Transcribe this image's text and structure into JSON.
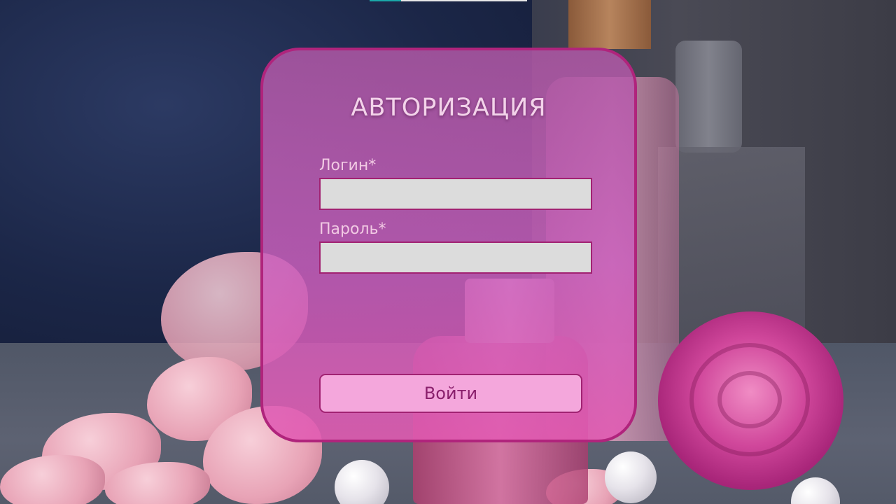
{
  "login": {
    "title": "АВТОРИЗАЦИЯ",
    "login_label": "Логин*",
    "login_value": "",
    "password_label": "Пароль*",
    "password_value": "",
    "submit_label": "Войти"
  },
  "colors": {
    "card_border": "#b0247c",
    "input_fill": "#dcdcdc",
    "button_fill": "#f4a7dc",
    "button_text": "#8a1f6c"
  }
}
